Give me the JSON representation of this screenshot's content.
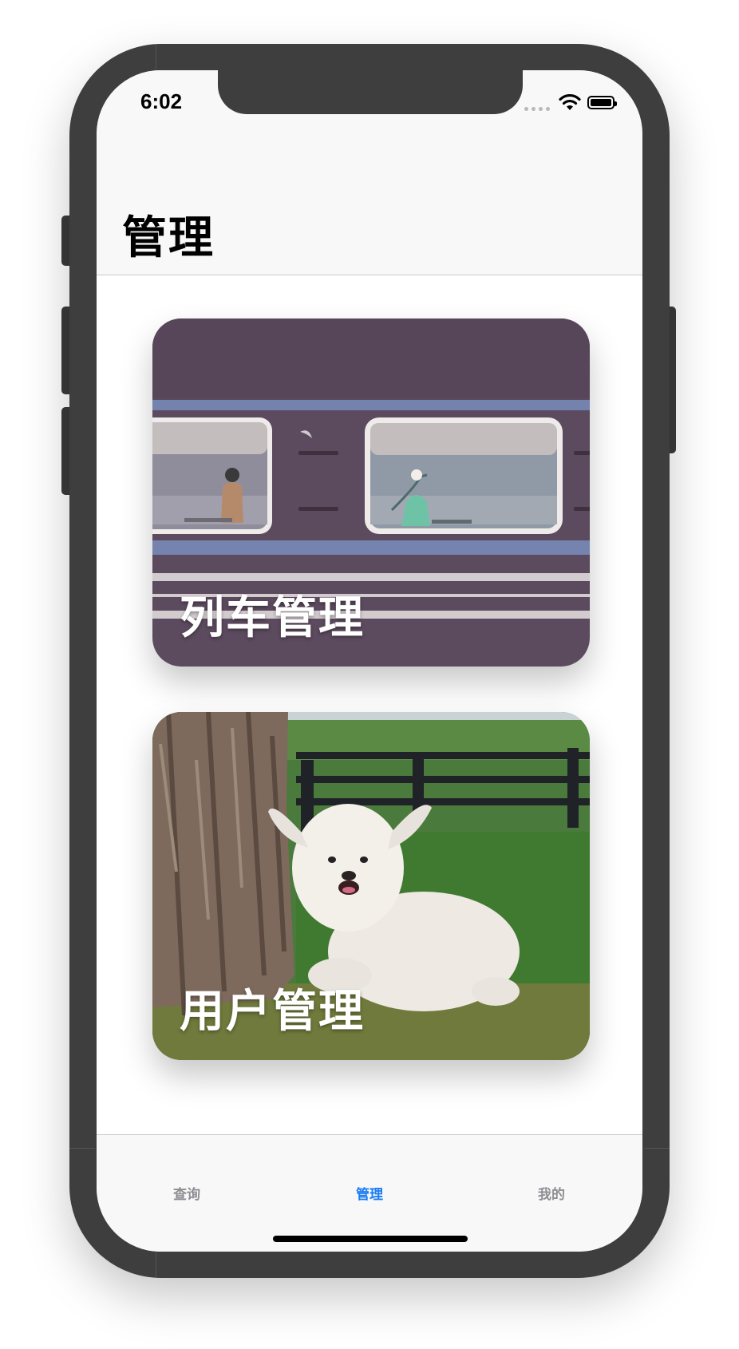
{
  "status_bar": {
    "time": "6:02"
  },
  "nav": {
    "title": "管理"
  },
  "cards": [
    {
      "label": "列车管理"
    },
    {
      "label": "用户管理"
    }
  ],
  "tabs": [
    {
      "label": "查询",
      "active": false
    },
    {
      "label": "管理",
      "active": true
    },
    {
      "label": "我的",
      "active": false
    }
  ],
  "colors": {
    "accent": "#1a7cf2",
    "tab_inactive": "#8e8e93",
    "frame": "#3e3e3e"
  }
}
